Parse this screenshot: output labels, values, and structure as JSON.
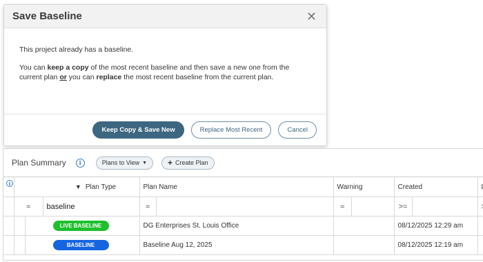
{
  "modal": {
    "title": "Save Baseline",
    "line1": "This project already has a baseline.",
    "line2_pre": "You can ",
    "line2_keep": "keep a copy",
    "line2_mid": " of the most recent baseline and then save a new one from the current plan ",
    "line2_or": "or",
    "line2_mid2": " you can ",
    "line2_replace": "replace",
    "line2_post": " the most recent baseline from the current plan.",
    "buttons": {
      "keep": "Keep Copy & Save New",
      "replace": "Replace Most Recent",
      "cancel": "Cancel"
    }
  },
  "panel": {
    "title": "Plan Summary",
    "plans_to_view": "Plans to View",
    "create_plan": "Create Plan",
    "columns": {
      "plan_type": "Plan Type",
      "plan_name": "Plan Name",
      "warning": "Warning",
      "created": "Created",
      "next": "L"
    },
    "filters": {
      "approx": "≈",
      "plan_type_value": "baseline",
      "created_op": ">=",
      "next_op": ">"
    },
    "rows": [
      {
        "type": "LIVE BASELINE",
        "name": "DG Enterprises St. Louis Office",
        "created": "08/12/2025 12:29 am"
      },
      {
        "type": "BASELINE",
        "name": "Baseline Aug 12, 2025",
        "created": "08/12/2025 12:19 am"
      }
    ]
  },
  "colors": {
    "live_baseline": "#1fbf2e",
    "baseline": "#1565e0",
    "primary": "#3d6680"
  }
}
